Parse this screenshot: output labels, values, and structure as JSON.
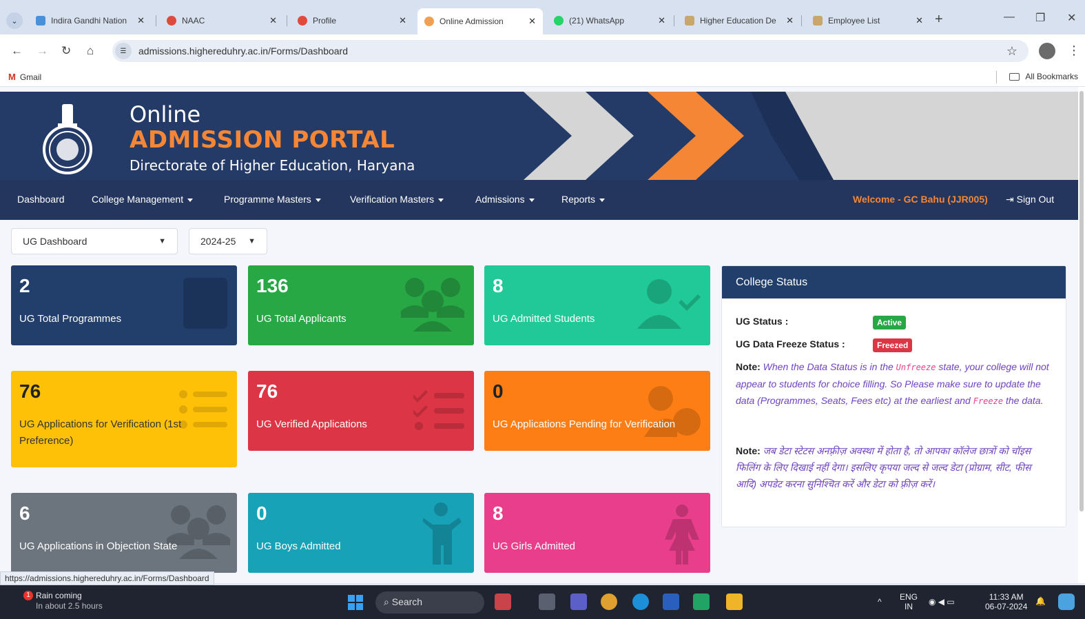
{
  "browser": {
    "tabs": [
      {
        "label": "Indira Gandhi Nation",
        "color": "#4a90d9"
      },
      {
        "label": "NAAC",
        "color": "#e04a3a"
      },
      {
        "label": "Profile",
        "color": "#e04a3a"
      },
      {
        "label": "Online Admission",
        "color": "#f0a050"
      },
      {
        "label": "(21) WhatsApp",
        "color": "#25d366"
      },
      {
        "label": "Higher Education De",
        "color": "#c9a66b"
      },
      {
        "label": "Employee List",
        "color": "#c9a66b"
      }
    ],
    "url": "admissions.highereduhry.ac.in/Forms/Dashboard",
    "bookmarks": {
      "gmail": "Gmail",
      "all": "All Bookmarks"
    },
    "status_url": "https://admissions.highereduhry.ac.in/Forms/Dashboard"
  },
  "banner": {
    "line1": "Online",
    "line2": "ADMISSION PORTAL",
    "line3": "Directorate of Higher Education, Haryana"
  },
  "nav": {
    "items": [
      "Dashboard",
      "College Management",
      "Programme Masters",
      "Verification Masters",
      "Admissions",
      "Reports"
    ],
    "welcome": "Welcome - GC Bahu (JJR005)",
    "signout": "Sign Out"
  },
  "filters": {
    "dashboard": "UG Dashboard",
    "year": "2024-25"
  },
  "cards": [
    {
      "value": "2",
      "label": "UG Total Programmes"
    },
    {
      "value": "136",
      "label": "UG Total Applicants"
    },
    {
      "value": "8",
      "label": "UG Admitted Students"
    },
    {
      "value": "76",
      "label": "UG Applications for Verification (1st Preference)"
    },
    {
      "value": "76",
      "label": "UG Verified Applications"
    },
    {
      "value": "0",
      "label": "UG Applications Pending for Verification"
    },
    {
      "value": "6",
      "label": "UG Applications in Objection State"
    },
    {
      "value": "0",
      "label": "UG Boys Admitted"
    },
    {
      "value": "8",
      "label": "UG Girls Admitted"
    }
  ],
  "college_status": {
    "title": "College Status",
    "ug_status_label": "UG Status :",
    "ug_status_value": "Active",
    "freeze_label": "UG Data Freeze Status :",
    "freeze_value": "Freezed",
    "note_label": "Note:",
    "note_en_1": "When the Data Status is in the",
    "note_en_unfreeze": "Unfreeze",
    "note_en_2": "state, your college will not appear to students for choice filling. So Please make sure to update the data (Programmes, Seats, Fees etc) at the earliest and",
    "note_en_freeze": "Freeze",
    "note_en_3": "the data.",
    "note_hi": "जब डेटा स्टेटस अनफ़्रीज़ अवस्था में होता है, तो आपका कॉलेज छात्रों को चॉइस फिलिंग के लिए दिखाई नहीं देगा। इसलिए कृपया जल्द से जल्द डेटा (प्रोग्राम, सीट, फीस आदि) अपडेट करना सुनिश्चित करें और डेटा को फ़्रीज़ करें।"
  },
  "taskbar": {
    "weather_title": "Rain coming",
    "weather_sub": "In about 2.5 hours",
    "weather_badge": "1",
    "search": "Search",
    "lang": "ENG",
    "region": "IN",
    "time": "11:33 AM",
    "date": "06-07-2024"
  }
}
